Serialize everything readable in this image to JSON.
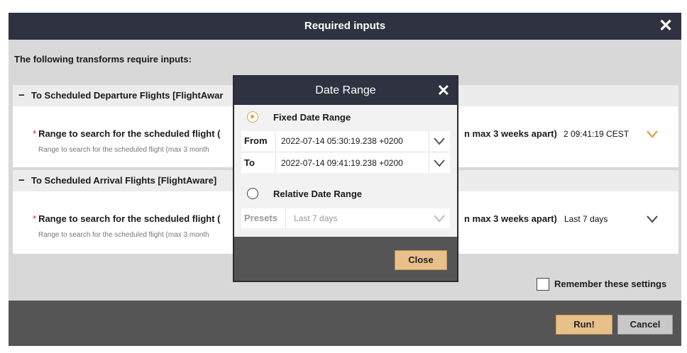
{
  "dialog": {
    "title": "Required inputs",
    "intro": "The following transforms require inputs:",
    "sections": [
      {
        "heading": "To Scheduled Departure Flights [FlightAwar",
        "field_label": "Range to search for the scheduled flight (",
        "field_help": "Range to search for the scheduled flight (max 3 month",
        "field_suffix": "n max 3 weeks apart)",
        "field_value": "2 09:41:19 CEST"
      },
      {
        "heading": "To Scheduled Arrival Flights [FlightAware]",
        "field_label": "Range to search for the scheduled flight (",
        "field_help": "Range to search for the scheduled flight (max 3 month",
        "field_suffix": "n max 3 weeks apart)",
        "field_value": "Last 7 days"
      }
    ],
    "required_marker": "*",
    "collapse_glyph": "−",
    "remember_label": "Remember these settings",
    "run_label": "Run!",
    "cancel_label": "Cancel"
  },
  "date_range_popup": {
    "title": "Date Range",
    "fixed_label": "Fixed Date Range",
    "from_label": "From",
    "from_value": "2022-07-14 05:30:19.238 +0200",
    "to_label": "To",
    "to_value": "2022-07-14 09:41:19.238 +0200",
    "relative_label": "Relative Date Range",
    "presets_label": "Presets",
    "presets_value": "Last 7 days",
    "close_label": "Close",
    "selected": "fixed"
  },
  "colors": {
    "titlebar": "#2f3241",
    "accent": "#e0a24a",
    "button": "#e8c08a"
  },
  "icons": {
    "close": "close-icon",
    "chevron": "chevron-down-icon"
  }
}
